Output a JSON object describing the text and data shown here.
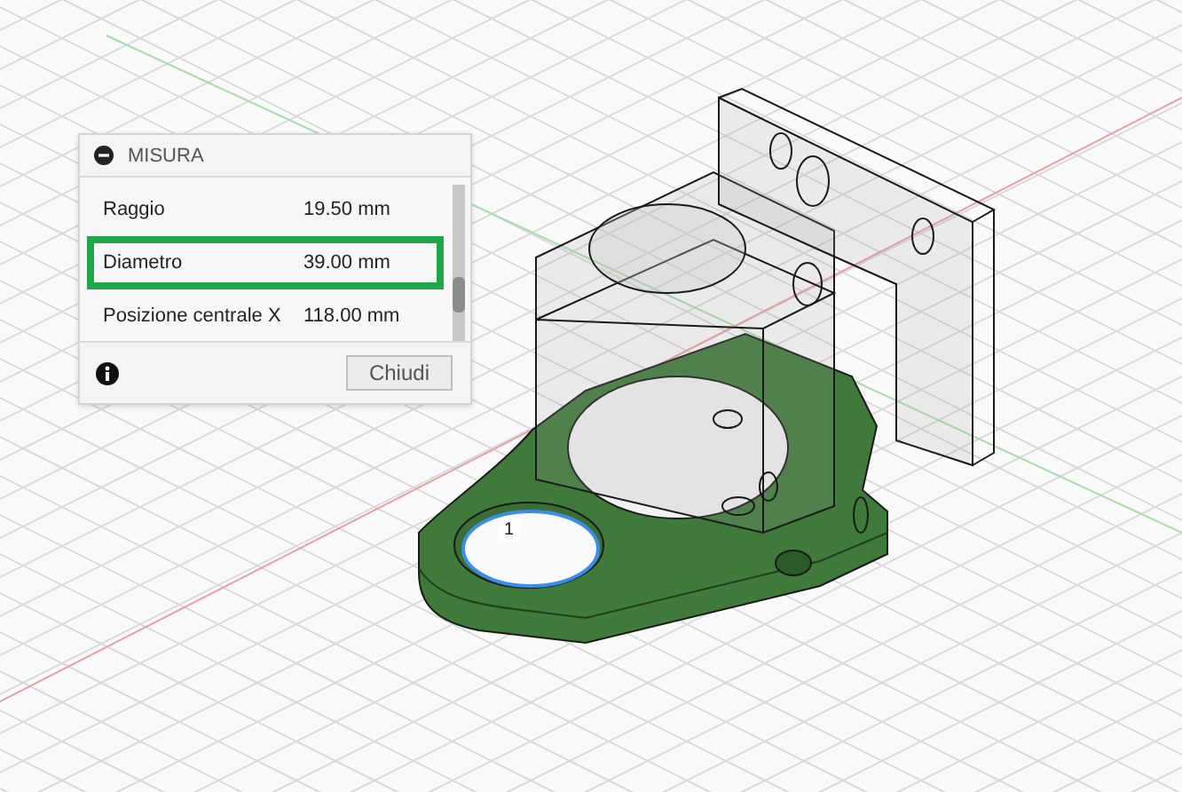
{
  "panel": {
    "title": "MISURA",
    "collapsed": false,
    "rows": [
      {
        "label": "Raggio",
        "value": "19.50 mm",
        "highlighted": false
      },
      {
        "label": "Diametro",
        "value": "39.00 mm",
        "highlighted": true
      },
      {
        "label": "Posizione centrale X",
        "value": "118.00 mm",
        "highlighted": false
      }
    ],
    "close_button": "Chiudi"
  },
  "viewport": {
    "selection_label": "1"
  }
}
